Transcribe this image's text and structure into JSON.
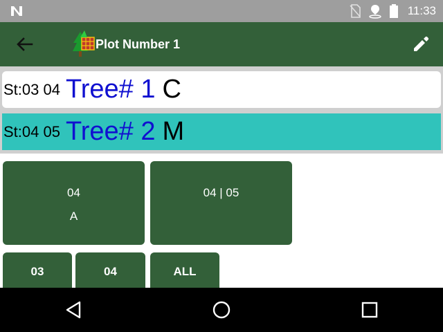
{
  "status_bar": {
    "time": "11:33",
    "icons": [
      "n-notification-icon",
      "no-sim-icon",
      "location-icon",
      "battery-icon"
    ]
  },
  "app_bar": {
    "title": "Plot Number 1",
    "icons": [
      "back-arrow-icon",
      "forest-plot-logo-icon",
      "edit-pencil-icon"
    ]
  },
  "trees": [
    {
      "st": "St:03 04",
      "tree": "Tree# 1",
      "code": "C",
      "selected": false
    },
    {
      "st": "St:04 05",
      "tree": "Tree# 2",
      "code": "M",
      "selected": true
    }
  ],
  "buttons": {
    "big1": {
      "line1": "04",
      "line2": "A"
    },
    "big2": {
      "line1": "04 | 05"
    },
    "small": [
      "03",
      "04",
      "ALL"
    ]
  },
  "nav_bar": {
    "icons": [
      "nav-back-icon",
      "nav-home-icon",
      "nav-recents-icon"
    ]
  },
  "colors": {
    "app_bar": "#336039",
    "selected_row": "#30c3bb",
    "tree_text": "#1010d0",
    "status_bar": "#9e9e9e"
  }
}
